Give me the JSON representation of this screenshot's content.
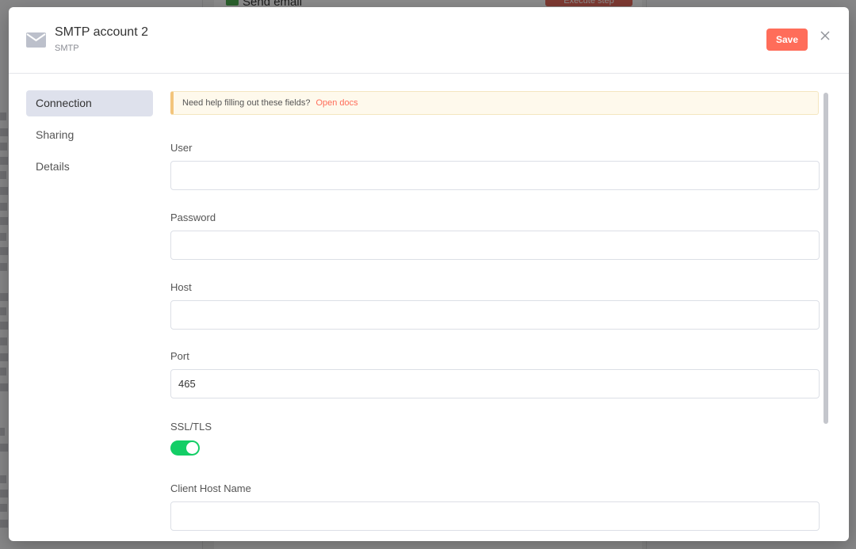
{
  "background": {
    "node_title": "Send email",
    "execute_label": "Execute step"
  },
  "modal": {
    "icon": "envelope-icon",
    "title": "SMTP account 2",
    "subtitle": "SMTP",
    "save_label": "Save",
    "close_icon": "close-icon"
  },
  "sidebar": {
    "items": [
      {
        "label": "Connection",
        "active": true
      },
      {
        "label": "Sharing",
        "active": false
      },
      {
        "label": "Details",
        "active": false
      }
    ]
  },
  "notice": {
    "text": "Need help filling out these fields?",
    "link": "Open docs"
  },
  "fields": {
    "user": {
      "label": "User",
      "value": ""
    },
    "password": {
      "label": "Password",
      "value": ""
    },
    "host": {
      "label": "Host",
      "value": ""
    },
    "port": {
      "label": "Port",
      "value": "465"
    },
    "ssl": {
      "label": "SSL/TLS",
      "enabled": true
    },
    "client_host": {
      "label": "Client Host Name",
      "value": ""
    }
  },
  "colors": {
    "accent": "#ff6d5a",
    "toggle_on": "#13ce66",
    "active_nav": "#dee1ec",
    "notice_bg": "#fef9ec",
    "notice_border": "#f3c57c"
  }
}
